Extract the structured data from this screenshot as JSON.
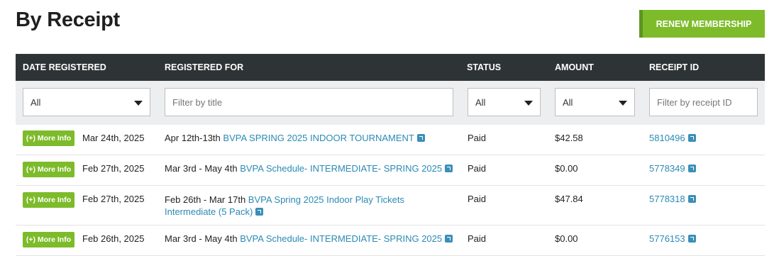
{
  "page": {
    "title": "By Receipt",
    "renew_label": "RENEW MEMBERSHIP"
  },
  "columns": [
    "DATE REGISTERED",
    "REGISTERED FOR",
    "STATUS",
    "AMOUNT",
    "RECEIPT ID"
  ],
  "filters": {
    "date": "All",
    "title_placeholder": "Filter by title",
    "status": "All",
    "amount": "All",
    "receipt_placeholder": "Filter by receipt ID"
  },
  "more_info_label": "(+) More Info",
  "rows": [
    {
      "date": "Mar 24th, 2025",
      "range": "Apr 12th-13th",
      "event": "BVPA SPRING 2025 INDOOR TOURNAMENT",
      "event2": "",
      "status": "Paid",
      "amount": "$42.58",
      "receipt": "5810496"
    },
    {
      "date": "Feb 27th, 2025",
      "range": "Mar 3rd - May 4th",
      "event": "BVPA Schedule- INTERMEDIATE- SPRING 2025",
      "event2": "",
      "status": "Paid",
      "amount": "$0.00",
      "receipt": "5778349"
    },
    {
      "date": "Feb 27th, 2025",
      "range": "Feb 26th - Mar 17th",
      "event": "BVPA Spring 2025 Indoor Play Tickets",
      "event2": "Intermediate (5 Pack)",
      "status": "Paid",
      "amount": "$47.84",
      "receipt": "5778318"
    },
    {
      "date": "Feb 26th, 2025",
      "range": "Mar 3rd - May 4th",
      "event": "BVPA Schedule- INTERMEDIATE- SPRING 2025",
      "event2": "",
      "status": "Paid",
      "amount": "$0.00",
      "receipt": "5776153"
    }
  ]
}
